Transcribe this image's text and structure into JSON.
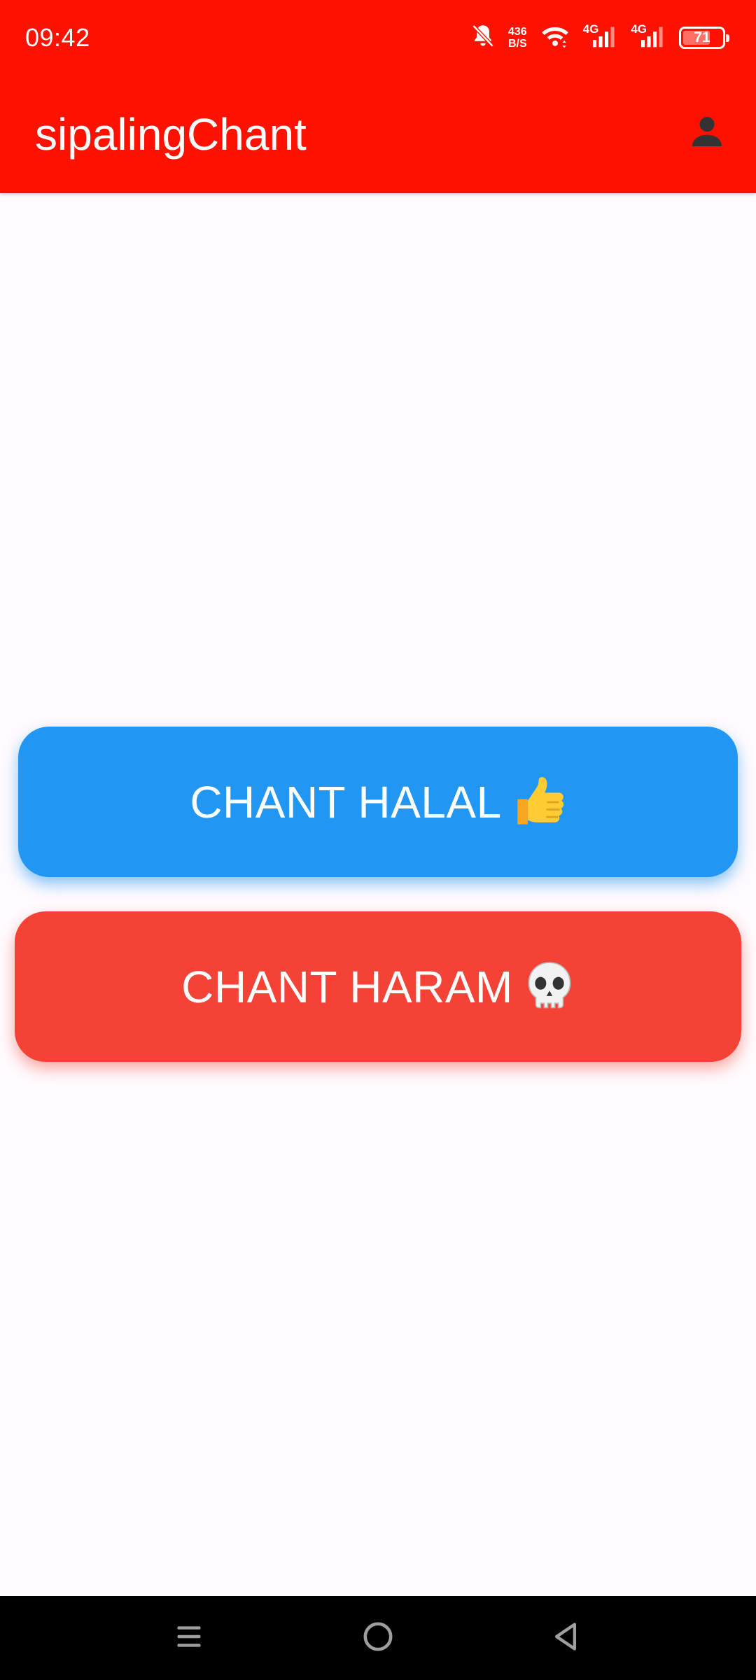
{
  "status_bar": {
    "time": "09:42",
    "net_speed_value": "436",
    "net_speed_unit": "B/S",
    "sim1_label": "4G",
    "sim2_label": "4G",
    "battery_level": "71",
    "icons": [
      "bell-off-icon",
      "wifi-icon",
      "signal-icon",
      "signal-icon",
      "battery-icon"
    ]
  },
  "app_bar": {
    "title": "sipalingChant",
    "account_icon": "person-icon"
  },
  "buttons": {
    "halal_label": "CHANT HALAL",
    "halal_emoji": "thumbs-up",
    "haram_label": "CHANT HARAM",
    "haram_emoji": "skull"
  },
  "nav_bar": {
    "icons": [
      "menu-icon",
      "home-icon",
      "back-icon"
    ]
  },
  "colors": {
    "primary": "#FF1100",
    "halal_button": "#2196F3",
    "haram_button": "#F44336",
    "background": "#FFFBFE"
  }
}
